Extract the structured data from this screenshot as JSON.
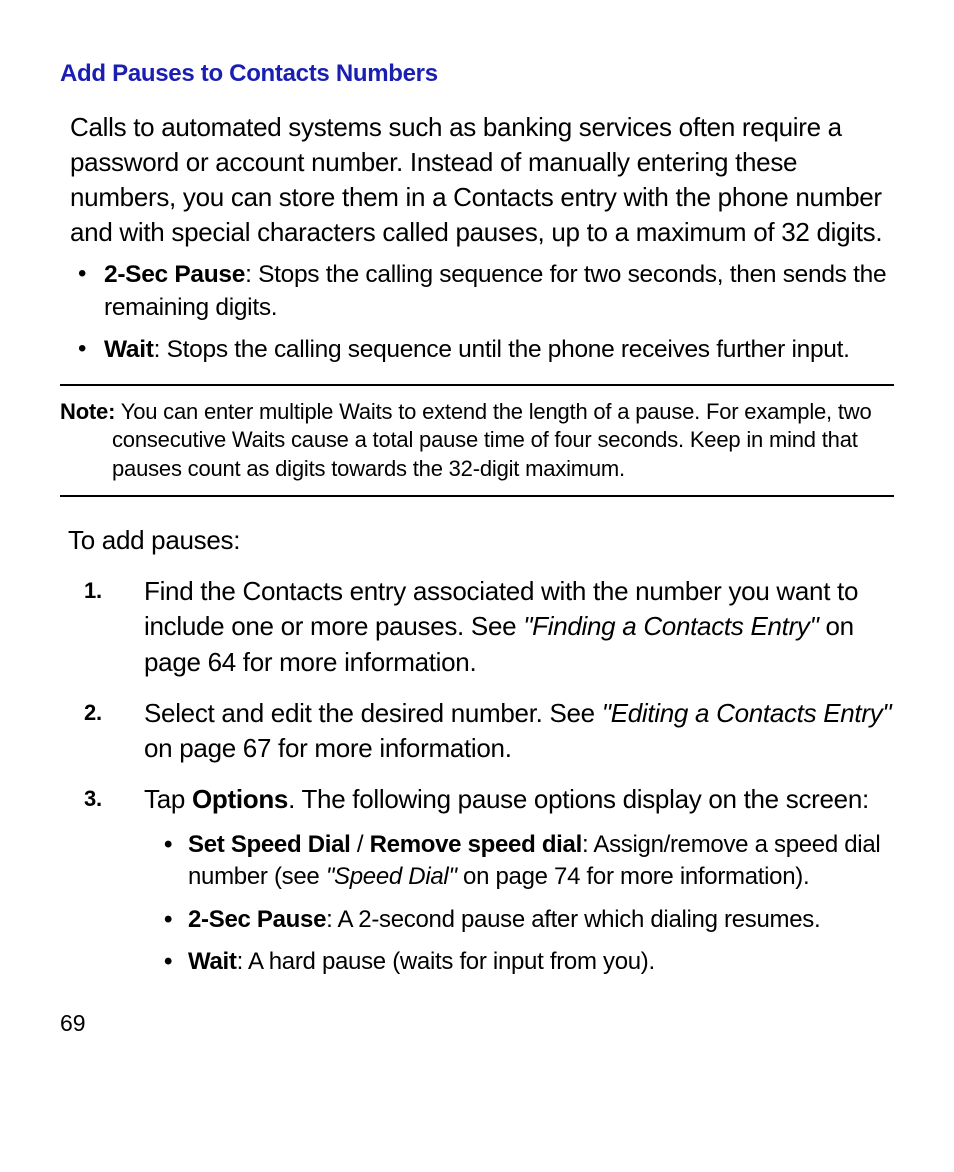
{
  "heading": "Add Pauses to Contacts Numbers",
  "intro": "Calls to automated systems such as banking services often require a password or account number. Instead of manually entering these numbers, you can store them in a Contacts entry with the phone number and with special characters called pauses, up to a maximum of 32 digits.",
  "pause_items": [
    {
      "title": "2-Sec Pause",
      "desc": ": Stops the calling sequence for two seconds, then sends the remaining digits."
    },
    {
      "title": "Wait",
      "desc": ": Stops the calling sequence until the phone receives further input."
    }
  ],
  "note_label": "Note:",
  "note_text": " You can enter multiple Waits to extend the length of a pause. For example, two consecutive Waits cause a total pause time of four seconds. Keep in mind that pauses count as digits towards the 32-digit maximum.",
  "to_add": "To add pauses:",
  "steps": {
    "s1_a": "Find the Contacts entry associated with the number you want to include one or more pauses. See ",
    "s1_ref": "\"Finding a Contacts Entry\"",
    "s1_b": " on page 64 for more information.",
    "s2_a": "Select and edit the desired number. See ",
    "s2_ref": "\"Editing a Contacts Entry\"",
    "s2_b": " on page 67 for more information.",
    "s3_a": "Tap ",
    "s3_opt": "Options",
    "s3_b": ". The following pause options display on the screen:"
  },
  "sub": {
    "i1_t1": "Set Speed Dial",
    "i1_sep": " / ",
    "i1_t2": "Remove speed dial",
    "i1_a": ": Assign/remove a speed dial number (see ",
    "i1_ref": "\"Speed Dial\"",
    "i1_b": " on page 74 for more information).",
    "i2_t": "2-Sec Pause",
    "i2_d": ": A 2-second pause after which dialing resumes.",
    "i3_t": "Wait",
    "i3_d": ": A hard pause (waits for input from you)."
  },
  "page_number": "69"
}
